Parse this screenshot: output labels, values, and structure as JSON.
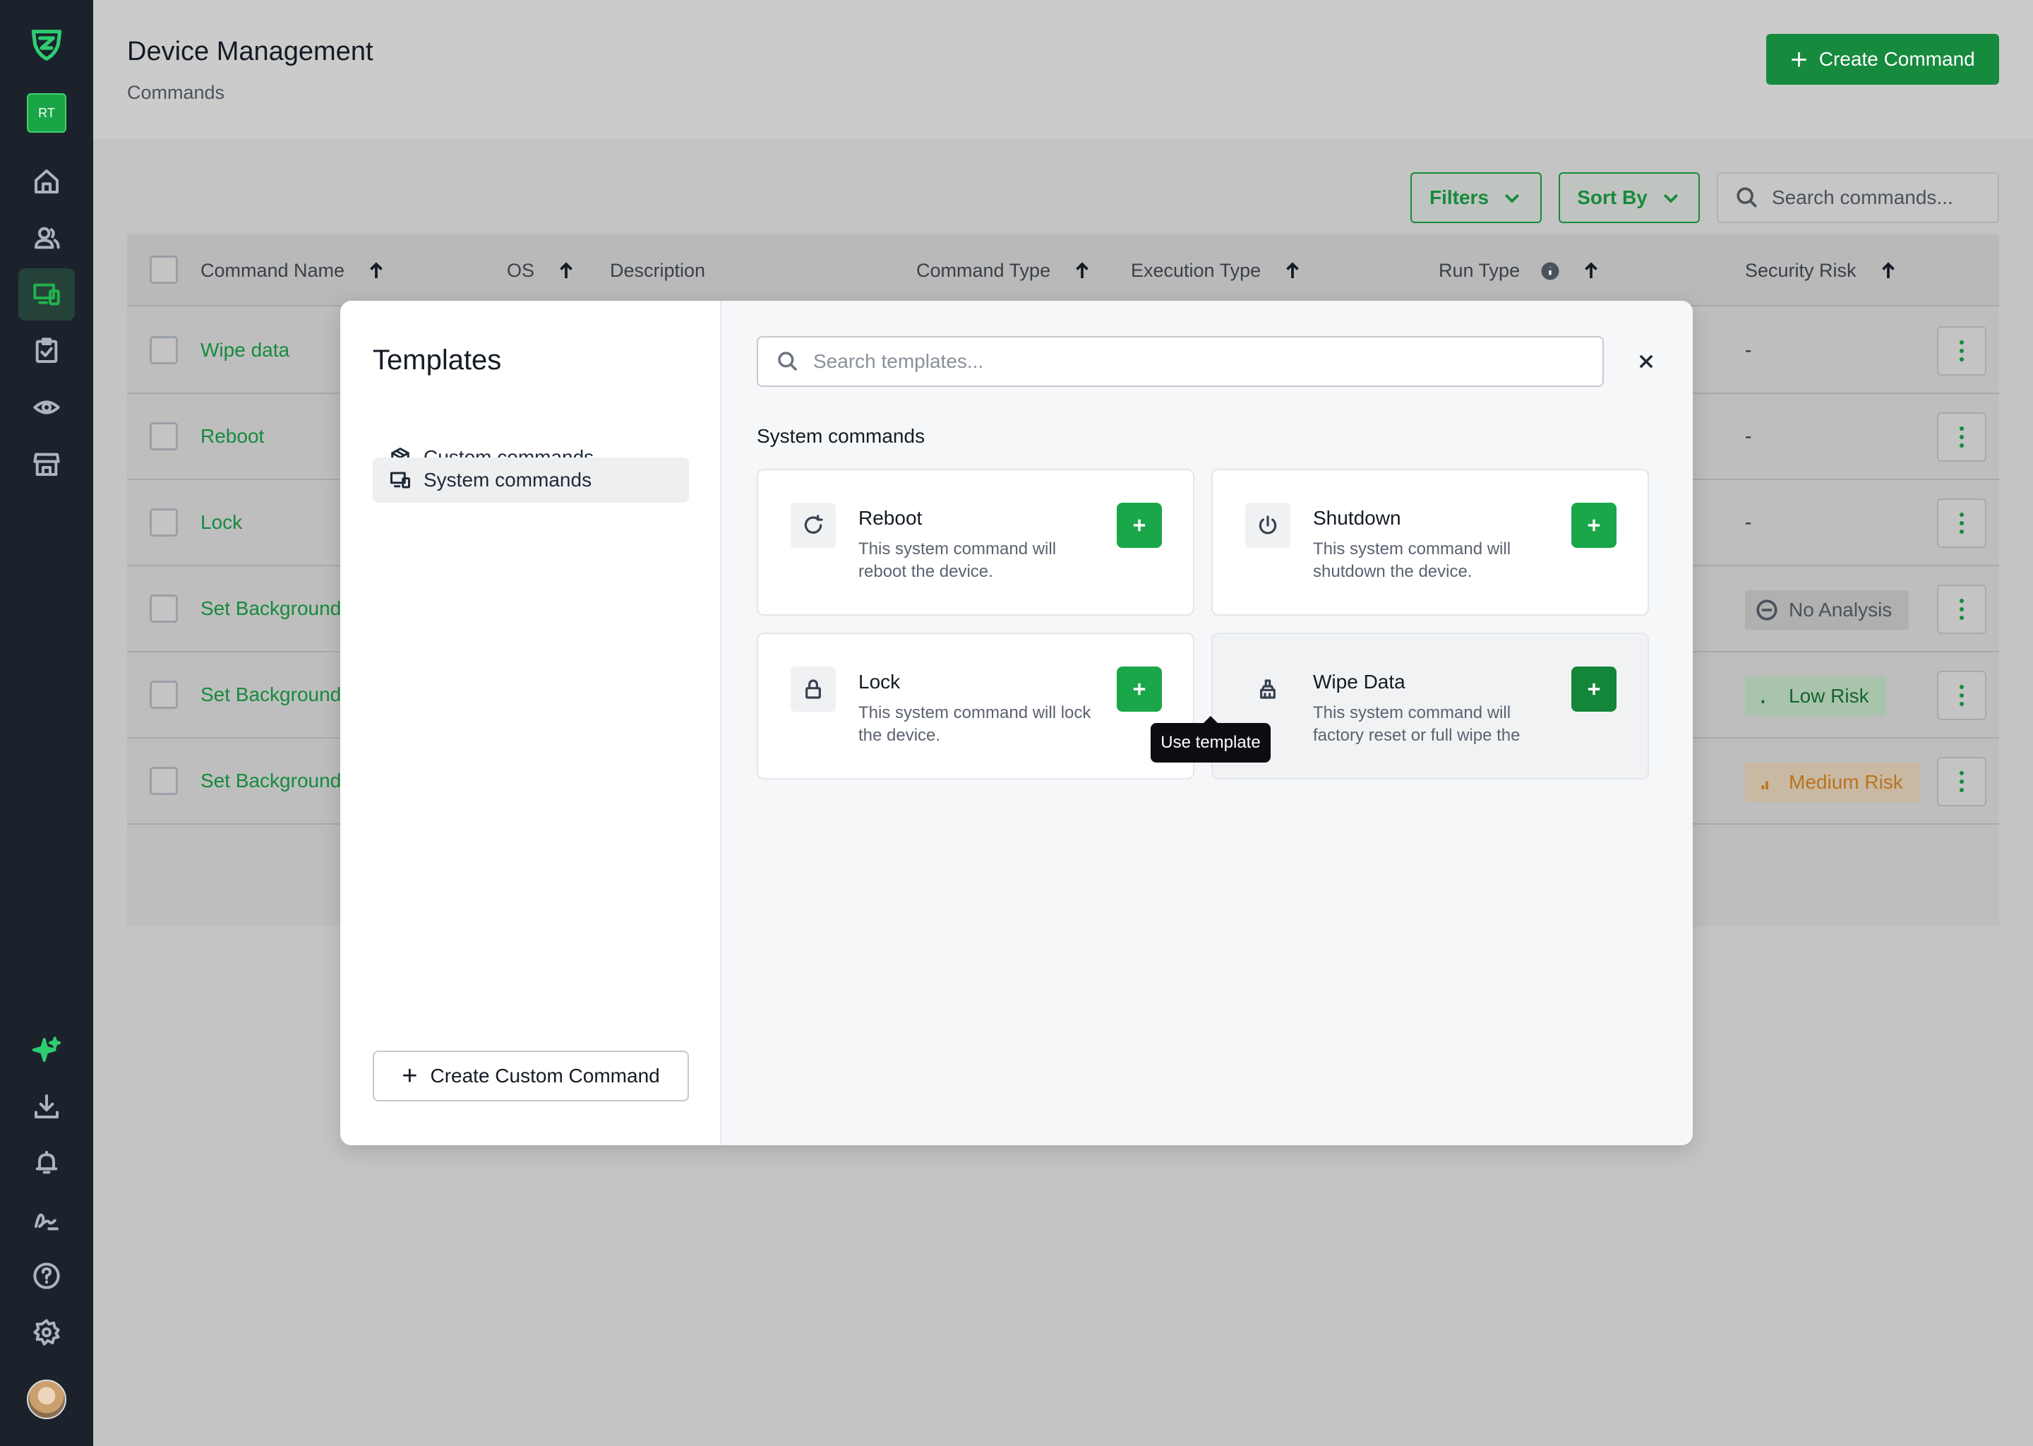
{
  "header": {
    "title": "Device Management",
    "subtitle": "Commands",
    "create_button": "Create Command"
  },
  "sidebar": {
    "user_initials": "RT",
    "items": [
      {
        "icon": "home-icon"
      },
      {
        "icon": "users-icon"
      },
      {
        "icon": "devices-icon",
        "active": true
      },
      {
        "icon": "clipboard-check-icon"
      },
      {
        "icon": "eye-icon"
      },
      {
        "icon": "store-icon"
      }
    ],
    "bottom_items": [
      {
        "icon": "sparkle-icon"
      },
      {
        "icon": "download-icon"
      },
      {
        "icon": "bell-icon"
      },
      {
        "icon": "signature-icon"
      },
      {
        "icon": "help-icon"
      },
      {
        "icon": "settings-icon"
      }
    ]
  },
  "toolbar": {
    "filters_label": "Filters",
    "sort_label": "Sort By",
    "search_placeholder": "Search commands..."
  },
  "table": {
    "columns": [
      "Command Name",
      "OS",
      "Description",
      "Command Type",
      "Execution Type",
      "Run Type",
      "Security Risk"
    ],
    "rows": [
      {
        "name": "Wipe data",
        "risk": "-"
      },
      {
        "name": "Reboot",
        "risk": "-"
      },
      {
        "name": "Lock",
        "risk": "-"
      },
      {
        "name": "Set Background",
        "risk": "No Analysis"
      },
      {
        "name": "Set Background",
        "risk": "Low Risk"
      },
      {
        "name": "Set Background",
        "risk": "Medium Risk"
      }
    ]
  },
  "modal": {
    "title": "Templates",
    "nav": [
      {
        "label": "Custom commands",
        "icon": "cube-icon",
        "active": false
      },
      {
        "label": "System commands",
        "icon": "devices-icon",
        "active": true
      }
    ],
    "create_custom_label": "Create Custom Command",
    "search_placeholder": "Search templates...",
    "section_label": "System commands",
    "cards": [
      {
        "title": "Reboot",
        "description": "This system command will reboot the device.",
        "icon": "refresh-icon"
      },
      {
        "title": "Shutdown",
        "description": "This system command will shutdown the device.",
        "icon": "power-icon"
      },
      {
        "title": "Lock",
        "description": "This system command will lock the device.",
        "icon": "lock-icon"
      },
      {
        "title": "Wipe Data",
        "description": "This system command will factory reset or full wipe the",
        "icon": "broom-icon"
      }
    ],
    "tooltip": "Use template"
  },
  "colors": {
    "brand_green": "#168a3d",
    "sidebar_bg": "#1b222c",
    "medium_risk": "#b8741f"
  }
}
